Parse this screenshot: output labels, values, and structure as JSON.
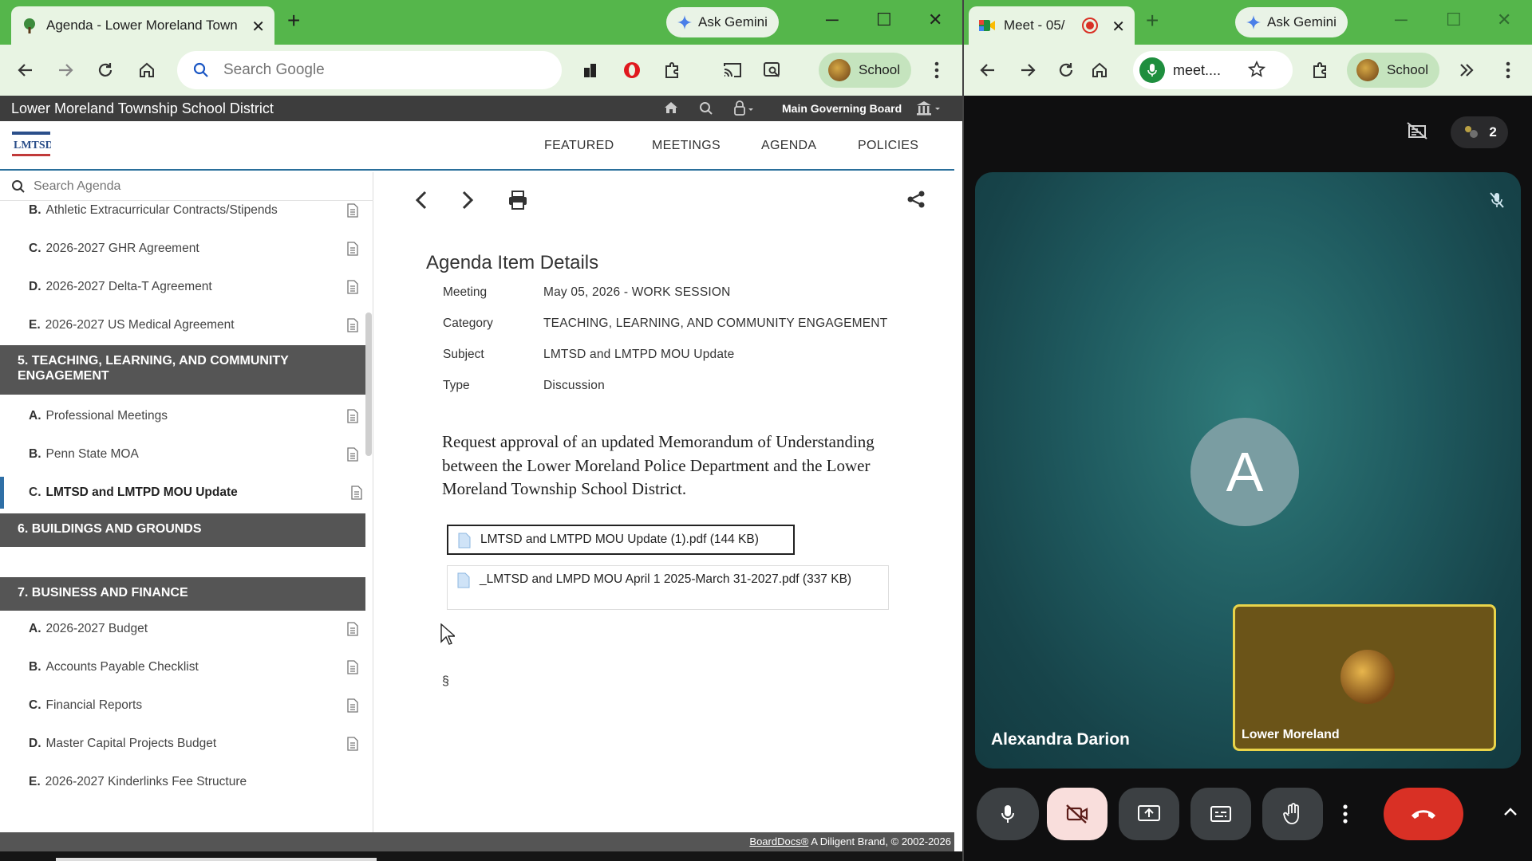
{
  "left_browser": {
    "tab_title": "Agenda - Lower Moreland Township",
    "gemini_label": "Ask Gemini",
    "search_placeholder": "Search Google",
    "profile_label": "School"
  },
  "boarddocs": {
    "site_title": "Lower Moreland Township School District",
    "board_name": "Main Governing Board",
    "logo_text": "LMTSD",
    "nav": [
      "FEATURED",
      "MEETINGS",
      "AGENDA",
      "POLICIES"
    ],
    "sidebar_search_placeholder": "Search Agenda",
    "sidebar": {
      "items_top": [
        {
          "letter": "B.",
          "label": "Athletic Extracurricular Contracts/Stipends"
        },
        {
          "letter": "C.",
          "label": "2026-2027 GHR Agreement"
        },
        {
          "letter": "D.",
          "label": "2026-2027 Delta-T Agreement"
        },
        {
          "letter": "E.",
          "label": "2026-2027 US Medical Agreement"
        }
      ],
      "section5": "5. TEACHING, LEARNING, AND COMMUNITY ENGAGEMENT",
      "items_s5": [
        {
          "letter": "A.",
          "label": "Professional Meetings"
        },
        {
          "letter": "B.",
          "label": "Penn State MOA"
        },
        {
          "letter": "C.",
          "label": "LMTSD and LMTPD MOU Update"
        }
      ],
      "section6": "6. BUILDINGS AND GROUNDS",
      "section7": "7. BUSINESS AND FINANCE",
      "items_s7": [
        {
          "letter": "A.",
          "label": "2026-2027 Budget"
        },
        {
          "letter": "B.",
          "label": "Accounts Payable Checklist"
        },
        {
          "letter": "C.",
          "label": "Financial Reports"
        },
        {
          "letter": "D.",
          "label": "Master Capital Projects Budget"
        },
        {
          "letter": "E.",
          "label": "2026-2027 Kinderlinks Fee Structure"
        }
      ]
    },
    "details": {
      "title": "Agenda Item Details",
      "meeting_label": "Meeting",
      "meeting_value": "May 05, 2026 - WORK SESSION",
      "category_label": "Category",
      "category_value": "TEACHING, LEARNING, AND COMMUNITY ENGAGEMENT",
      "subject_label": "Subject",
      "subject_value": "LMTSD and LMTPD MOU Update",
      "type_label": "Type",
      "type_value": "Discussion",
      "description": "Request approval of an updated Memorandum of Understanding between the Lower Moreland Police Department and the Lower Moreland Township School District.",
      "attachments": [
        "LMTSD and LMTPD MOU Update (1).pdf (144 KB)",
        "_LMTSD and LMPD MOU April 1 2025-March 31-2027.pdf (337 KB)"
      ],
      "section_mark": "§"
    },
    "footer_link": "BoardDocs®",
    "footer_text": " A Diligent Brand, © 2002-2026"
  },
  "right_browser": {
    "tab_title": "Meet - 05/",
    "gemini_label": "Ask Gemini",
    "url_text": "meet....",
    "profile_label": "School"
  },
  "meet": {
    "participant_count": "2",
    "main_initial": "A",
    "main_name": "Alexandra Darion",
    "self_name": "Lower Moreland"
  },
  "colors": {
    "chrome_green": "#55b64b",
    "toolbar_green": "#e8f4e3",
    "bd_header": "#3d3d3d",
    "section_bg": "#555555",
    "hangup_red": "#d93025",
    "self_border": "#e9d44a"
  }
}
